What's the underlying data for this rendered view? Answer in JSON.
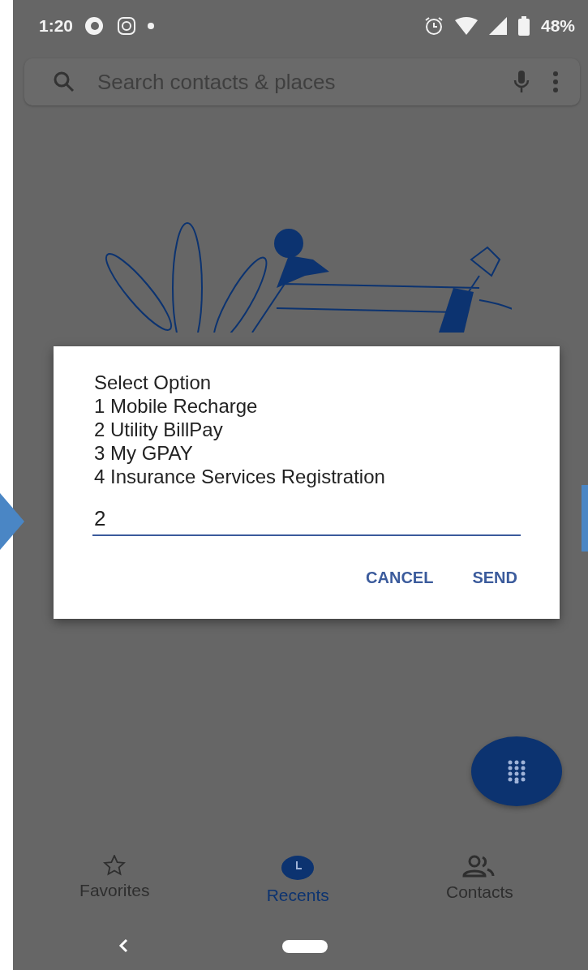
{
  "status_bar": {
    "time": "1:20",
    "battery": "48%"
  },
  "search": {
    "placeholder": "Search contacts & places"
  },
  "dialog": {
    "lines": [
      "Select Option",
      "1 Mobile Recharge",
      "2 Utility BillPay",
      "3 My GPAY",
      "4 Insurance Services Registration"
    ],
    "input": {
      "value": "2"
    },
    "buttons": [
      "CANCEL",
      "SEND"
    ]
  },
  "nav_tabs": [
    {
      "kind": "favorites",
      "label": "Favorites",
      "selected": false
    },
    {
      "kind": "recents",
      "label": "Recents",
      "selected": true
    },
    {
      "kind": "contacts",
      "label": "Contacts",
      "selected": false
    }
  ]
}
